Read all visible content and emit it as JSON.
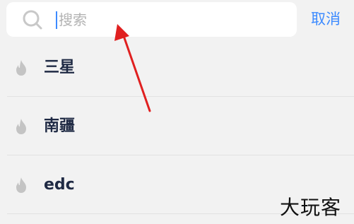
{
  "search": {
    "placeholder": "搜索",
    "value": "",
    "cancel_label": "取消"
  },
  "suggestions": {
    "items": [
      {
        "label": "三星",
        "icon": "fire-icon"
      },
      {
        "label": "南疆",
        "icon": "fire-icon"
      },
      {
        "label": "edc",
        "icon": "fire-icon"
      }
    ]
  },
  "annotation": {
    "color": "#e02020",
    "points_to": "search-input"
  },
  "watermark": {
    "text": "大玩客"
  },
  "colors": {
    "accent": "#3d8bff",
    "background": "#f2f2f2",
    "label": "#1f2a44",
    "icon": "#c4c4c4"
  }
}
